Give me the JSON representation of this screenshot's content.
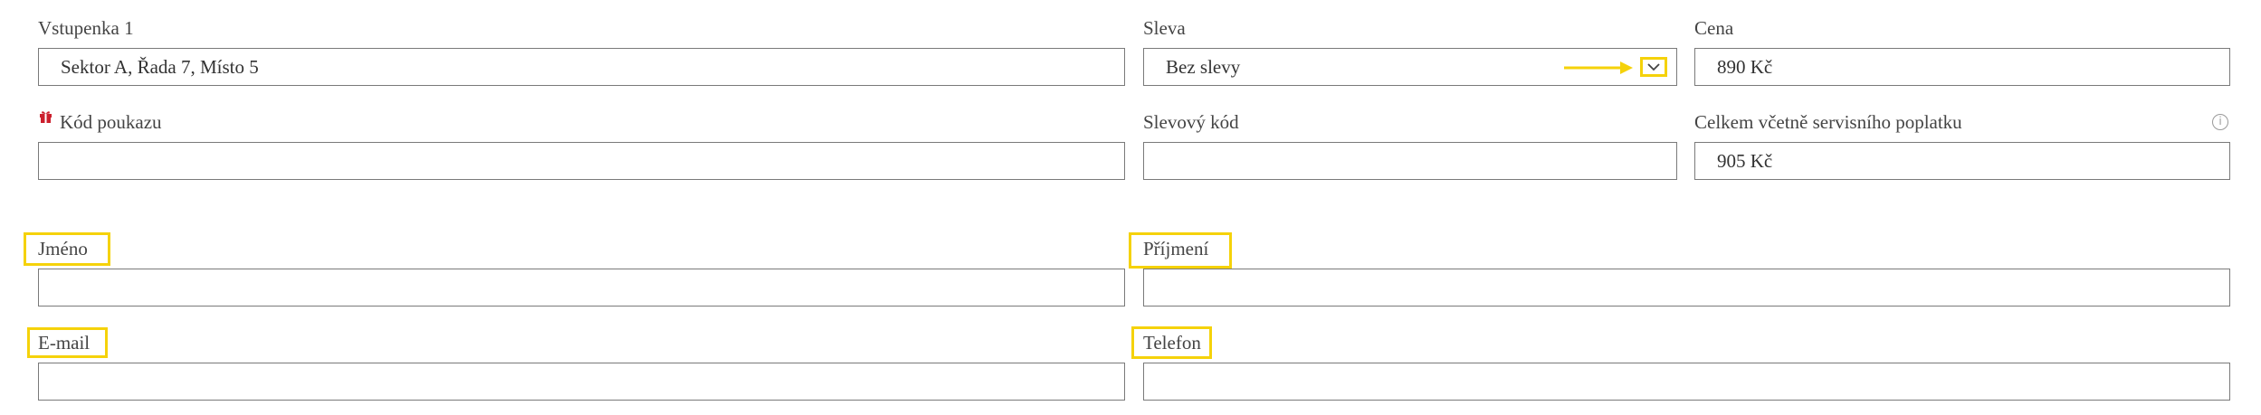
{
  "ticket": {
    "label": "Vstupenka 1",
    "value": "Sektor A, Řada 7, Místo 5"
  },
  "discount": {
    "label": "Sleva",
    "selected": "Bez slevy",
    "icon": "chevron-down-icon"
  },
  "price": {
    "label": "Cena",
    "value": "890 Kč"
  },
  "voucher": {
    "label": "Kód poukazu",
    "value": "",
    "icon": "gift-icon"
  },
  "discount_code": {
    "label": "Slevový kód",
    "value": ""
  },
  "total": {
    "label": "Celkem včetně servisního poplatku",
    "value": "905 Kč",
    "info_icon": "info-icon",
    "info_glyph": "i"
  },
  "first_name": {
    "label": "Jméno",
    "value": ""
  },
  "last_name": {
    "label": "Příjmení",
    "value": ""
  },
  "email": {
    "label": "E-mail",
    "value": ""
  },
  "phone": {
    "label": "Telefon",
    "value": ""
  },
  "colors": {
    "annotation_highlight": "#f5d20a",
    "gift_icon": "#cc1f2d",
    "border": "#7a7a7a"
  }
}
